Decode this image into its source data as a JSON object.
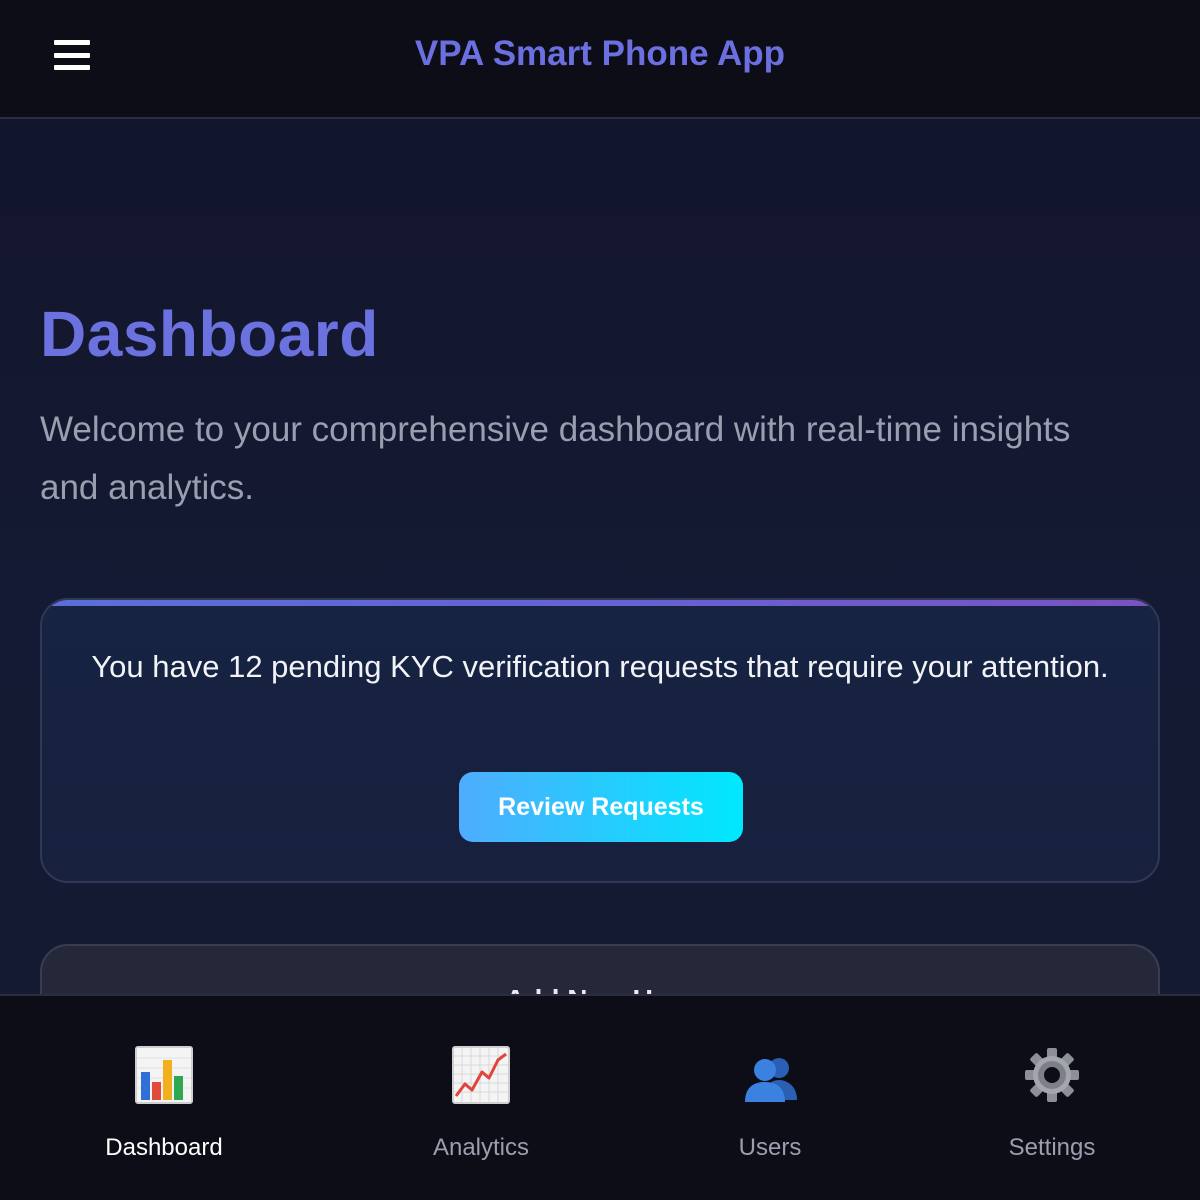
{
  "header": {
    "title": "VPA Smart Phone App",
    "menu_icon": "hamburger-menu-icon"
  },
  "page": {
    "title": "Dashboard",
    "subtitle": "Welcome to your comprehensive dashboard with real-time insights and analytics."
  },
  "alert": {
    "message": "You have 12 pending KYC verification requests that require your attention.",
    "button_label": "Review Requests",
    "button_gradient": [
      "#4facfe",
      "#00e8fe"
    ]
  },
  "next_card": {
    "title": "Add New User"
  },
  "bottom_nav": {
    "items": [
      {
        "label": "Dashboard",
        "icon": "bar-chart-icon",
        "active": true
      },
      {
        "label": "Analytics",
        "icon": "line-chart-icon",
        "active": false
      },
      {
        "label": "Users",
        "icon": "users-icon",
        "active": false
      },
      {
        "label": "Settings",
        "icon": "gear-icon",
        "active": false
      }
    ]
  },
  "colors": {
    "accent": "#6b72e0",
    "background": "#12142a",
    "bar": "#0c0d16"
  }
}
